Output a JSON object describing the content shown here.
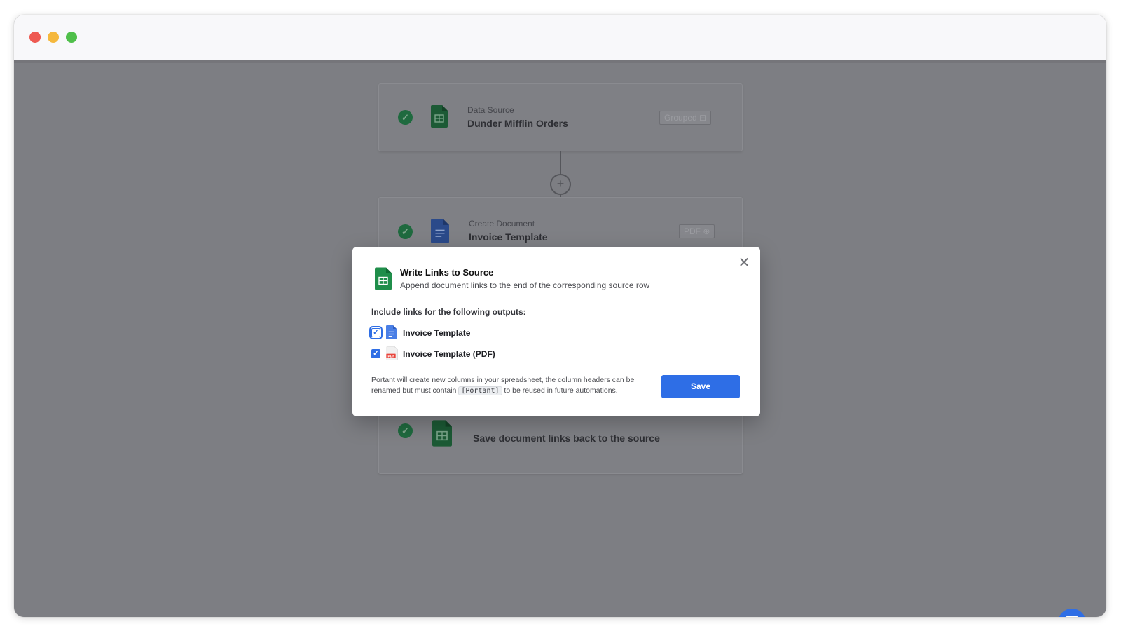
{
  "steps": [
    {
      "label": "Data Source",
      "title": "Dunder Mifflin Orders",
      "tag": "Grouped",
      "icon": "sheets-icon"
    },
    {
      "label": "Create Document",
      "title": "Invoice Template",
      "tag": "PDF",
      "icon": "docs-icon"
    },
    {
      "label": "",
      "title": "Save document links back to the source",
      "icon": "sheets-icon"
    }
  ],
  "modal": {
    "title": "Write Links to Source",
    "subtitle": "Append document links to the end of the corresponding source row",
    "include_label": "Include links for the following outputs:",
    "options": [
      {
        "label": "Invoice Template",
        "checked": true,
        "icon": "docs-icon"
      },
      {
        "label": "Invoice Template (PDF)",
        "checked": true,
        "icon": "pdf-icon"
      }
    ],
    "note_before": "Portant will create new columns in your spreadsheet, the column headers can be renamed but must contain ",
    "note_code": "[Portant]",
    "note_after": " to be reused in future automations.",
    "save_label": "Save"
  },
  "colors": {
    "accent": "#2e6ee6",
    "sheets": "#1f8e4a",
    "docs": "#4a7fe6",
    "success": "#1f6a3f"
  }
}
